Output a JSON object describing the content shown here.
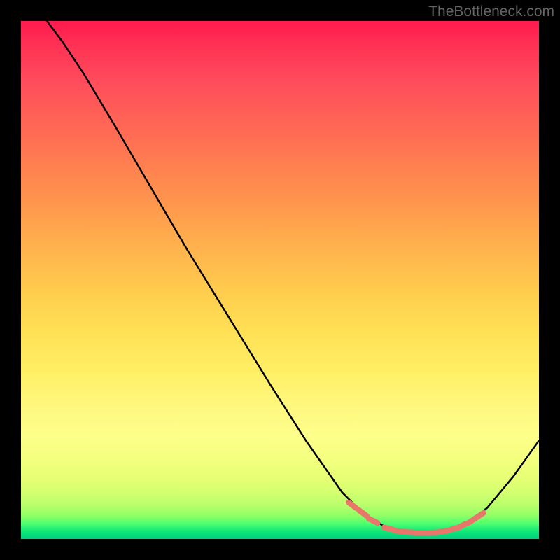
{
  "watermark": "TheBottleneck.com",
  "chart_data": {
    "type": "line",
    "title": "",
    "xlabel": "",
    "ylabel": "",
    "xlim": [
      0,
      100
    ],
    "ylim": [
      0,
      100
    ],
    "curve_points": [
      {
        "x": 5,
        "y": 100
      },
      {
        "x": 8,
        "y": 96
      },
      {
        "x": 12,
        "y": 90
      },
      {
        "x": 18,
        "y": 80
      },
      {
        "x": 25,
        "y": 68
      },
      {
        "x": 32,
        "y": 56
      },
      {
        "x": 40,
        "y": 43
      },
      {
        "x": 48,
        "y": 30
      },
      {
        "x": 55,
        "y": 19
      },
      {
        "x": 62,
        "y": 9
      },
      {
        "x": 66,
        "y": 5
      },
      {
        "x": 70,
        "y": 2.5
      },
      {
        "x": 74,
        "y": 1.5
      },
      {
        "x": 78,
        "y": 1.2
      },
      {
        "x": 82,
        "y": 1.5
      },
      {
        "x": 86,
        "y": 3
      },
      {
        "x": 90,
        "y": 6
      },
      {
        "x": 95,
        "y": 12
      },
      {
        "x": 100,
        "y": 19
      }
    ],
    "marker_points": [
      {
        "x": 64,
        "y": 6.5
      },
      {
        "x": 66,
        "y": 5
      },
      {
        "x": 68,
        "y": 3.5
      },
      {
        "x": 71,
        "y": 2
      },
      {
        "x": 73,
        "y": 1.5
      },
      {
        "x": 75,
        "y": 1.3
      },
      {
        "x": 77,
        "y": 1.2
      },
      {
        "x": 79,
        "y": 1.2
      },
      {
        "x": 81,
        "y": 1.4
      },
      {
        "x": 83,
        "y": 1.8
      },
      {
        "x": 85,
        "y": 2.5
      },
      {
        "x": 87,
        "y": 3.5
      },
      {
        "x": 88.5,
        "y": 4.5
      }
    ],
    "colors": {
      "curve": "#000000",
      "marker": "#e8766b",
      "gradient_top": "#ff1a4d",
      "gradient_mid": "#ffe055",
      "gradient_bottom": "#00d080"
    }
  }
}
